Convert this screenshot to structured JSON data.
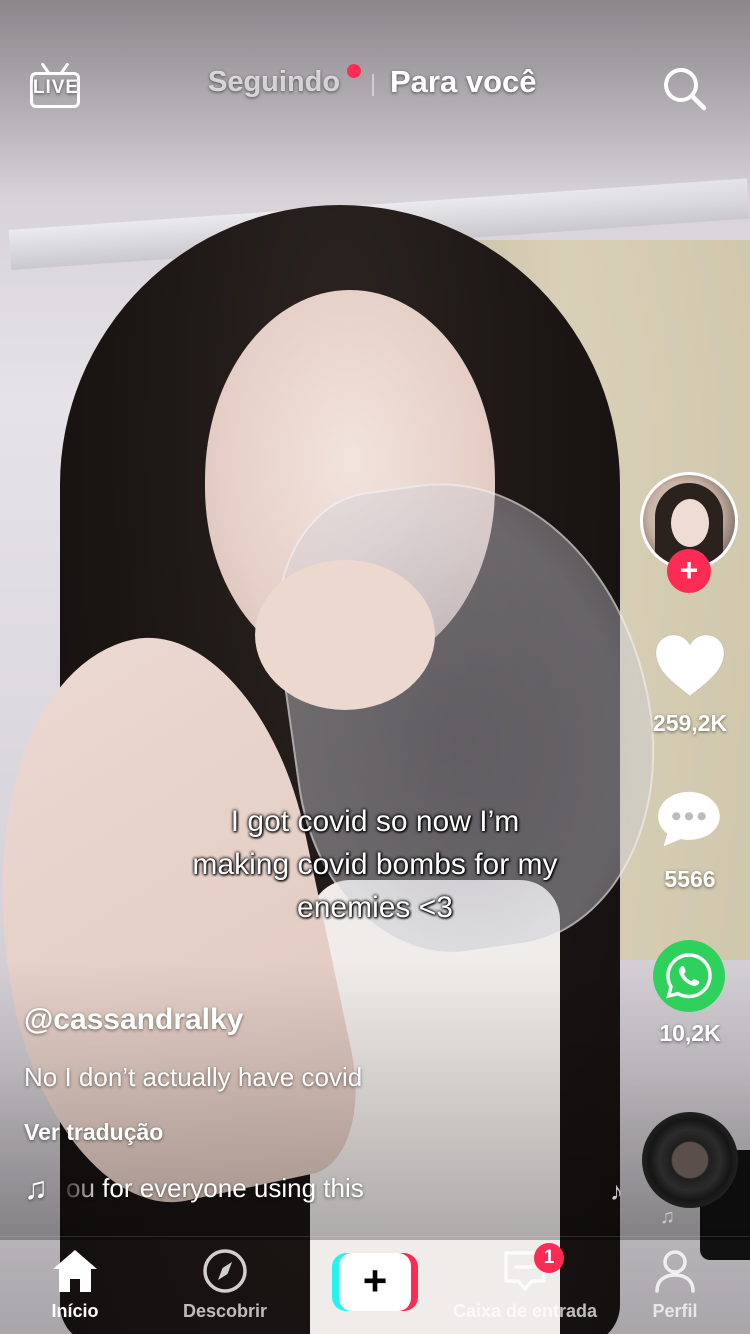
{
  "header": {
    "live_label": "LIVE",
    "tabs": [
      {
        "label": "Seguindo",
        "active": false,
        "has_dot": true
      },
      {
        "label": "Para você",
        "active": true
      }
    ],
    "search_icon": "search-icon"
  },
  "video": {
    "caption_lines": [
      "I got covid so now I’m",
      "making covid bombs for my",
      "enemies <3"
    ]
  },
  "post": {
    "username": "@cassandralky",
    "description": "No I don’t actually have covid",
    "translate_label": "Ver tradução",
    "sound_text": "ou for everyone using this",
    "music_icon": "music-note-icon"
  },
  "rail": {
    "likes": "259,2K",
    "comments": "5566",
    "shares": "10,2K",
    "follow_symbol": "+"
  },
  "nav": {
    "items": [
      {
        "label": "Início",
        "icon": "home-icon",
        "active": true
      },
      {
        "label": "Descobrir",
        "icon": "compass-icon"
      },
      {
        "label": "+",
        "icon": "create-icon"
      },
      {
        "label": "Caixa de entrada",
        "icon": "inbox-icon",
        "badge": "1"
      },
      {
        "label": "Perfil",
        "icon": "profile-icon"
      }
    ]
  },
  "colors": {
    "accent_red": "#fe2c55",
    "accent_cyan": "#25f4ee",
    "whatsapp_green": "#2fd15d"
  }
}
